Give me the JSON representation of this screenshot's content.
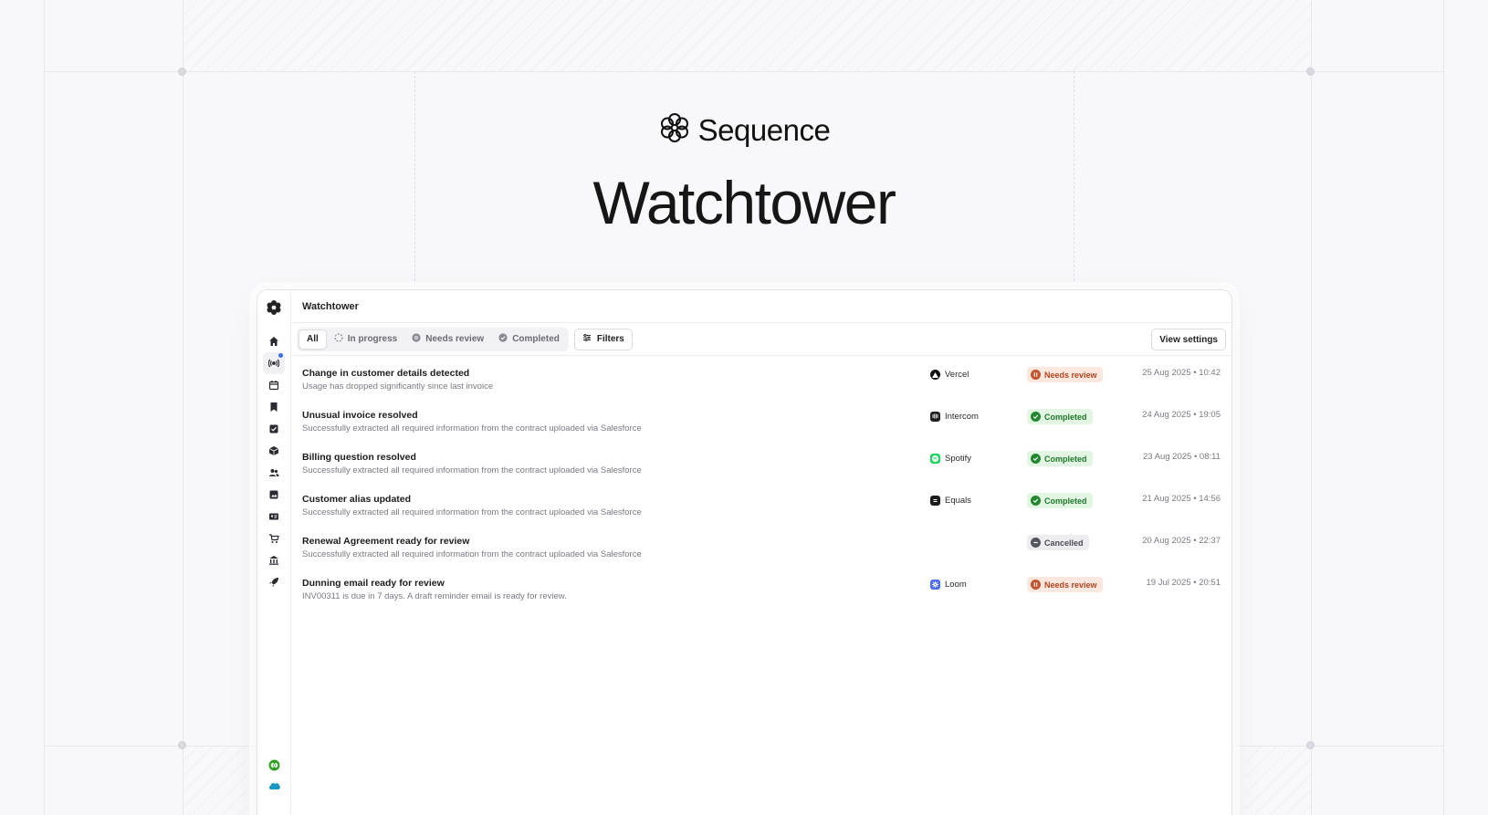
{
  "brand": {
    "name": "Sequence"
  },
  "hero": {
    "title": "Watchtower"
  },
  "app": {
    "page_title": "Watchtower",
    "tabs": [
      {
        "label": "All",
        "icon": ""
      },
      {
        "label": "In progress",
        "icon": "progress-dashed-icon"
      },
      {
        "label": "Needs review",
        "icon": "pause-circle-icon"
      },
      {
        "label": "Completed",
        "icon": "check-circle-icon"
      }
    ],
    "filters_label": "Filters",
    "view_settings_label": "View settings",
    "sidebar_icons": [
      "home-icon",
      "broadcast-icon",
      "calendar-icon",
      "bookmark-icon",
      "checklist-icon",
      "package-icon",
      "users-icon",
      "image-icon",
      "id-card-icon",
      "cart-icon",
      "bank-icon",
      "rocket-icon"
    ],
    "sidebar_bottom_icons": [
      "quickbooks-icon",
      "salesforce-icon"
    ],
    "rows": [
      {
        "title": "Change in customer details detected",
        "subtitle": "Usage has dropped significantly since last invoice",
        "company": "Vercel",
        "company_icon": "vercel-logo-icon",
        "status": "Needs review",
        "status_kind": "review",
        "timestamp": "25 Aug 2025 • 10:42"
      },
      {
        "title": "Unusual invoice resolved",
        "subtitle": "Successfully extracted all required information from the contract uploaded via Salesforce",
        "company": "Intercom",
        "company_icon": "intercom-logo-icon",
        "status": "Completed",
        "status_kind": "completed",
        "timestamp": "24 Aug 2025 • 19:05"
      },
      {
        "title": "Billing question resolved",
        "subtitle": "Successfully extracted all required information from the contract uploaded via Salesforce",
        "company": "Spotify",
        "company_icon": "spotify-logo-icon",
        "status": "Completed",
        "status_kind": "completed",
        "timestamp": "23 Aug 2025 • 08:11"
      },
      {
        "title": "Customer alias updated",
        "subtitle": "Successfully extracted all required information from the contract uploaded via Salesforce",
        "company": "Equals",
        "company_icon": "equals-logo-icon",
        "status": "Completed",
        "status_kind": "completed",
        "timestamp": "21 Aug 2025 • 14:56"
      },
      {
        "title": "Renewal Agreement ready for review",
        "subtitle": "Successfully extracted all required information from the contract uploaded via Salesforce",
        "company": "",
        "company_icon": "",
        "status": "Cancelled",
        "status_kind": "cancelled",
        "timestamp": "20 Aug 2025 • 22:37"
      },
      {
        "title": "Dunning email ready for review",
        "subtitle": "INV00311 is due in 7 days. A draft reminder email is ready for review.",
        "company": "Loom",
        "company_icon": "loom-logo-icon",
        "status": "Needs review",
        "status_kind": "review",
        "timestamp": "19 Jul 2025 • 20:51"
      }
    ]
  },
  "colors": {
    "accent": "#3b6ef5",
    "review_bg": "#fde8e0",
    "review_fg": "#b4431f",
    "completed_bg": "#e3f5e3",
    "completed_fg": "#1f7a2c",
    "cancelled_bg": "#ededf0",
    "cancelled_fg": "#4a4a55"
  }
}
